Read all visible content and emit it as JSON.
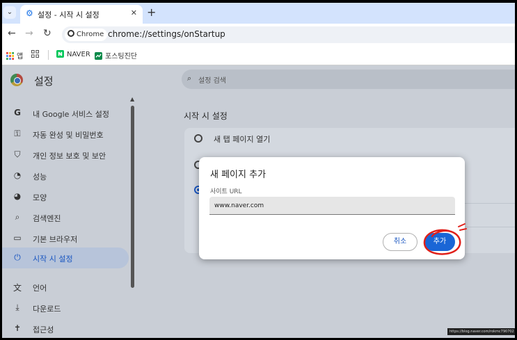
{
  "tab": {
    "title": "설정 - 시작 시 설정",
    "close_glyph": "✕",
    "new_tab_glyph": "+"
  },
  "toolbar": {
    "back_glyph": "←",
    "forward_glyph": "→",
    "reload_glyph": "↻",
    "chip_label": "Chrome",
    "url": "chrome://settings/onStartup"
  },
  "bookmarks": [
    {
      "label": "앱",
      "icon": "apps-icon"
    },
    {
      "label": "",
      "icon": "grid-icon"
    },
    {
      "label": "NAVER",
      "icon": "naver-icon"
    },
    {
      "label": "포스팅진단",
      "icon": "chart-icon"
    }
  ],
  "settings": {
    "title": "설정",
    "search_placeholder": "설정 검색",
    "section_title": "시작 시 설정",
    "sidebar": [
      {
        "label": "내 Google 서비스 설정",
        "icon": "google-icon",
        "glyph": "G"
      },
      {
        "label": "자동 완성 및 비밀번호",
        "icon": "key-icon",
        "glyph": "⚿"
      },
      {
        "label": "개인 정보 보호 및 보안",
        "icon": "shield-icon",
        "glyph": "⛉"
      },
      {
        "label": "성능",
        "icon": "gauge-icon",
        "glyph": "◔"
      },
      {
        "label": "모양",
        "icon": "palette-icon",
        "glyph": "◕"
      },
      {
        "label": "검색엔진",
        "icon": "search-icon",
        "glyph": "⌕"
      },
      {
        "label": "기본 브라우저",
        "icon": "browser-icon",
        "glyph": "▭"
      },
      {
        "label": "시작 시 설정",
        "icon": "power-icon",
        "glyph": "⏻",
        "active": true
      },
      {
        "label": "언어",
        "icon": "translate-icon",
        "glyph": "文"
      },
      {
        "label": "다운로드",
        "icon": "download-icon",
        "glyph": "⤓"
      },
      {
        "label": "접근성",
        "icon": "accessibility-icon",
        "glyph": "✝"
      }
    ],
    "startup_options": [
      {
        "label": "새 탭 페이지 열기",
        "selected": false
      }
    ]
  },
  "dialog": {
    "title": "새 페이지 추가",
    "field_label": "사이트 URL",
    "field_value": "www.naver.com",
    "cancel_label": "취소",
    "add_label": "추가"
  },
  "colors": {
    "accent": "#1a66d6",
    "annotation": "#e0201a"
  },
  "watermark": "https://blog.naver.com/rokmc790702"
}
